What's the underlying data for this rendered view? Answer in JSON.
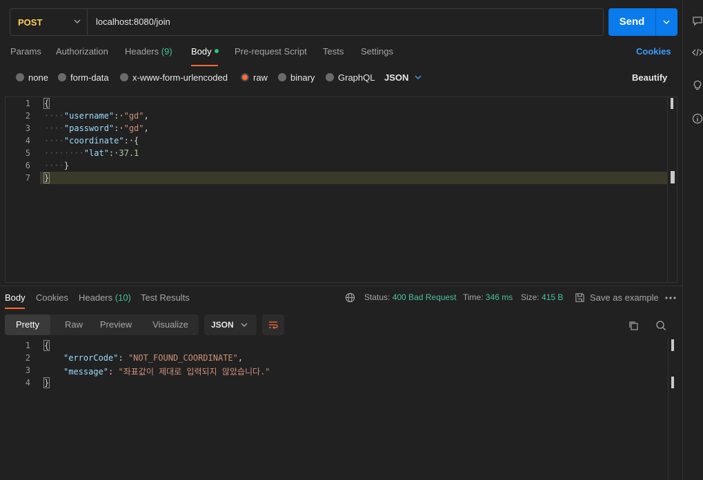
{
  "request": {
    "method": "POST",
    "url": "localhost:8080/join",
    "send_label": "Send"
  },
  "request_tabs": {
    "params": "Params",
    "authorization": "Authorization",
    "headers": "Headers",
    "headers_count": "(9)",
    "body": "Body",
    "pre_request": "Pre-request Script",
    "tests": "Tests",
    "settings": "Settings",
    "cookies": "Cookies"
  },
  "body_types": {
    "none": "none",
    "form_data": "form-data",
    "urlencoded": "x-www-form-urlencoded",
    "raw": "raw",
    "binary": "binary",
    "graphql": "GraphQL",
    "format": "JSON",
    "beautify": "Beautify",
    "selected": "raw"
  },
  "request_body": {
    "line_numbers": [
      "1",
      "2",
      "3",
      "4",
      "5",
      "6",
      "7"
    ],
    "username_key": "\"username\"",
    "username_value": "\"gd\"",
    "password_key": "\"password\"",
    "password_value": "\"gd\"",
    "coordinate_key": "\"coordinate\"",
    "lat_key": "\"lat\"",
    "lat_value": "37.1"
  },
  "response_tabs": {
    "body": "Body",
    "cookies": "Cookies",
    "headers": "Headers",
    "headers_count": "(10)",
    "test_results": "Test Results"
  },
  "response_meta": {
    "status_label": "Status:",
    "status_value": "400 Bad Request",
    "time_label": "Time:",
    "time_value": "346 ms",
    "size_label": "Size:",
    "size_value": "415 B",
    "save_example": "Save as example"
  },
  "response_view": {
    "pretty": "Pretty",
    "raw": "Raw",
    "preview": "Preview",
    "visualize": "Visualize",
    "format": "JSON"
  },
  "response_body": {
    "line_numbers": [
      "1",
      "2",
      "3",
      "4"
    ],
    "error_code_key": "\"errorCode\"",
    "error_code_value": "\"NOT_FOUND_COORDINATE\"",
    "message_key": "\"message\"",
    "message_value": "\"좌표값이 제대로 입력되지 않았습니다.\""
  },
  "colors": {
    "accent": "#ff6c37",
    "send": "#097bed",
    "method": "#ffd159",
    "status_ok_text": "#49c2a0"
  }
}
